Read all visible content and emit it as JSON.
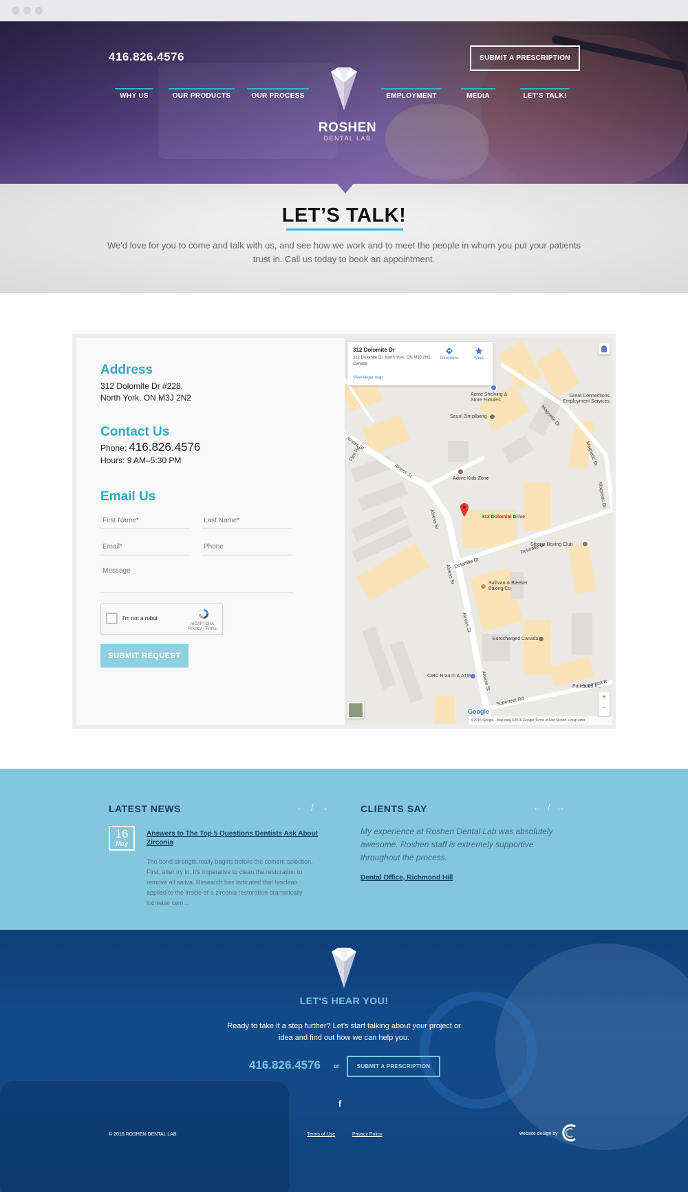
{
  "header": {
    "phone": "416.826.4576",
    "cta": "SUBMIT A PRESCRIPTION",
    "nav": [
      "WHY US",
      "OUR PRODUCTS",
      "OUR PROCESS",
      "EMPLOYMENT",
      "MEDIA",
      "LET'S TALK!"
    ],
    "logo_name": "ROSHEN",
    "logo_sub": "DENTAL LAB"
  },
  "intro": {
    "title": "LET’S TALK!",
    "text": "We'd love for you to come and talk with us, and see how we work and to meet the people in whom you put your patients trust in. Call us today to book an appointment."
  },
  "contact": {
    "address_heading": "Address",
    "address_line1": "312 Dolomite Dr #228,",
    "address_line2": "North York, ON M3J 2N2",
    "contact_heading": "Contact Us",
    "phone_label": "Phone:",
    "phone_value": "416.826.4576",
    "hours_label": "Hours:",
    "hours_value": "9 AM–5:30 PM",
    "email_heading": "Email Us",
    "form": {
      "first_name": "First Name*",
      "last_name": "Last Name*",
      "email": "Email*",
      "phone": "Phone",
      "message": "Message",
      "captcha_label": "I'm not a robot",
      "captcha_brand": "reCAPTCHA",
      "captcha_links": "Privacy - Terms",
      "submit": "SUBMIT REQUEST"
    }
  },
  "map": {
    "card_title": "312 Dolomite Dr",
    "card_address": "312 Dolomite Dr, North York, ON M3J 2N2, Canada",
    "directions": "Directions",
    "save": "Save",
    "larger": "View larger map",
    "pin_label": "312 Dolomite Drive",
    "places": {
      "acme": "Acme Shelving & Store Fixtures",
      "great": "Great Connections Employment Services",
      "seoul": "Seoul Zimzilbang",
      "active": "Active Kids Zone",
      "siberia": "Siberia Boxing Club",
      "sullivan": "Sullivan & Bleeker Baking Co",
      "euro": "Eurocharged Canada",
      "cibc": "CIBC Branch & ATM",
      "patterned": "Patterned Ir..."
    },
    "streets": {
      "alness1": "Alness St",
      "alness2": "Alness St",
      "alness3": "Alness St",
      "alness4": "Alness St",
      "alness5": "Alness St",
      "dolomite1": "Dolomite Dr",
      "dolomite2": "Dolomite Dr",
      "magnetic1": "Magnetic Dr",
      "magnetic2": "Magnetic Dr",
      "magnetic3": "Magnetic Dr",
      "flint": "Flint Rd",
      "supertest1": "Supertest Rd",
      "supertest2": "Supertest R"
    },
    "google": "Google",
    "footer": "©2016 Google · Map data ©2016 Google    Terms of Use    Report a map error",
    "zoom_in": "+",
    "zoom_out": "−"
  },
  "news": {
    "heading": "LATEST NEWS",
    "arrows": "← / →",
    "day": "16",
    "month": "May",
    "title": "Answers to The Top 5 Questions Dentists Ask About Zirconia",
    "body": "The bond strength really begins before the cement selection. First, after try in, it's imperative to clean the restoration to remove all saliva. Research has indicated that Ivoclean applied to the inside of a zirconia restoration dramatically increase cem..."
  },
  "clients": {
    "heading": "CLIENTS SAY",
    "arrows": "← / →",
    "quote": "My experience at Roshen Dental Lab was absolutely awesome. Roshen staff is extremely supportive throughout the process.",
    "source": "Dental Office, Richmond Hill"
  },
  "footer": {
    "title": "LET'S HEAR YOU!",
    "text": "Ready to take it a step further? Let's start talking about your project or idea and find out how we can help you.",
    "phone": "416.826.4576",
    "or": "or",
    "cta": "SUBMIT A PRESCRIPTION",
    "facebook": "f",
    "copyright": "© 2016 ROSHEN DENTAL LAB",
    "terms": "Terms of Use",
    "privacy": "Privacy Policy",
    "credit": "website design by"
  },
  "colors": {
    "accent": "#2fb6cf",
    "heading_teal": "#2fa9c6",
    "news_band": "#84c6dc",
    "footer_blue": "#134b8a"
  }
}
